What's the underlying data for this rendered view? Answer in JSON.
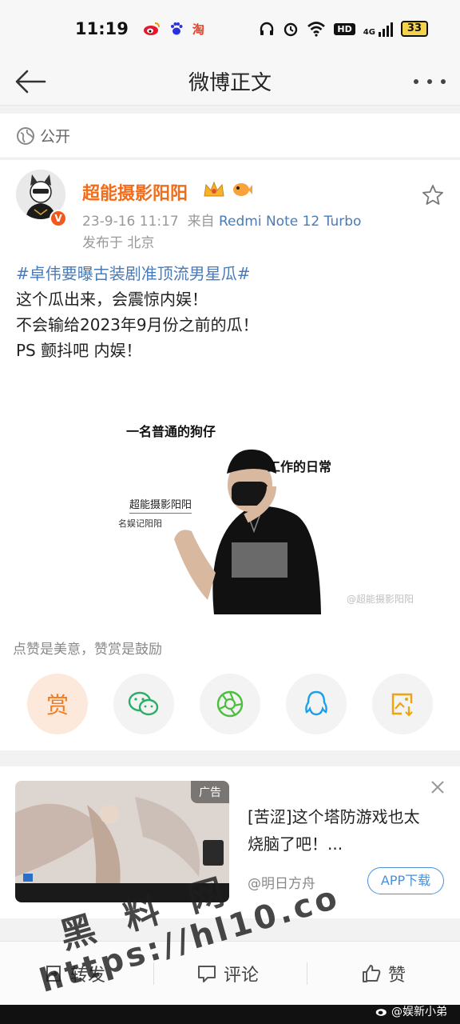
{
  "status_bar": {
    "time": "11:19",
    "app_icons": [
      "weibo-icon",
      "baidu-icon",
      "taobao-icon"
    ],
    "taobao_label": "淘",
    "hd_label": "HD",
    "signal_label": "4G",
    "battery": "33"
  },
  "nav": {
    "title": "微博正文"
  },
  "visibility": {
    "label": "公开"
  },
  "post": {
    "username": "超能摄影阳阳",
    "datetime": "23-9-16 11:17",
    "from_label": "来自",
    "device": "Redmi Note 12 Turbo",
    "location": "发布于 北京",
    "verified_badge": "V",
    "topic": "#卓伟要曝古装剧准顶流男星瓜#",
    "lines": [
      "这个瓜出来，会震惊内娱！",
      "不会输给2023年9月份之前的瓜！",
      "PS 颤抖吧 内娱！"
    ],
    "image": {
      "caption_top": "一名普通的狗仔",
      "caption_right": "工作的日常",
      "name_line1": "超能摄影阳阳",
      "name_line2": "名娱记阳阳",
      "watermark": "@超能摄影阳阳"
    }
  },
  "reward": {
    "hint": "点赞是美意，赞赏是鼓励",
    "reward_label": "赏"
  },
  "ad": {
    "tag": "广告",
    "text": "[苦涩]这个塔防游戏也太烧脑了吧！...",
    "source": "@明日方舟",
    "download_label": "APP下载"
  },
  "bottom_bar": {
    "repost": "转发",
    "comment": "评论",
    "like": "赞"
  },
  "overlay": {
    "watermark_zh": "黑 料 网",
    "watermark_url": "https://hl10.co",
    "credit": "@娱新小弟"
  },
  "colors": {
    "accent_orange": "#f26c1a",
    "link_blue": "#4a7bb7",
    "download_blue": "#4a90d9"
  }
}
